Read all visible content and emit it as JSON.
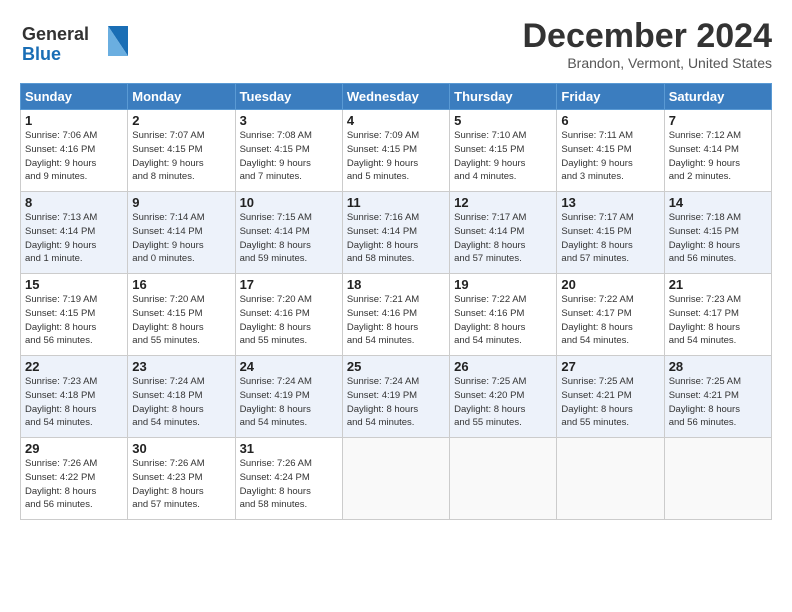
{
  "logo": {
    "line1": "General",
    "line2": "Blue"
  },
  "title": "December 2024",
  "subtitle": "Brandon, Vermont, United States",
  "days_of_week": [
    "Sunday",
    "Monday",
    "Tuesday",
    "Wednesday",
    "Thursday",
    "Friday",
    "Saturday"
  ],
  "weeks": [
    [
      {
        "day": "1",
        "info": "Sunrise: 7:06 AM\nSunset: 4:16 PM\nDaylight: 9 hours\nand 9 minutes."
      },
      {
        "day": "2",
        "info": "Sunrise: 7:07 AM\nSunset: 4:15 PM\nDaylight: 9 hours\nand 8 minutes."
      },
      {
        "day": "3",
        "info": "Sunrise: 7:08 AM\nSunset: 4:15 PM\nDaylight: 9 hours\nand 7 minutes."
      },
      {
        "day": "4",
        "info": "Sunrise: 7:09 AM\nSunset: 4:15 PM\nDaylight: 9 hours\nand 5 minutes."
      },
      {
        "day": "5",
        "info": "Sunrise: 7:10 AM\nSunset: 4:15 PM\nDaylight: 9 hours\nand 4 minutes."
      },
      {
        "day": "6",
        "info": "Sunrise: 7:11 AM\nSunset: 4:15 PM\nDaylight: 9 hours\nand 3 minutes."
      },
      {
        "day": "7",
        "info": "Sunrise: 7:12 AM\nSunset: 4:14 PM\nDaylight: 9 hours\nand 2 minutes."
      }
    ],
    [
      {
        "day": "8",
        "info": "Sunrise: 7:13 AM\nSunset: 4:14 PM\nDaylight: 9 hours\nand 1 minute."
      },
      {
        "day": "9",
        "info": "Sunrise: 7:14 AM\nSunset: 4:14 PM\nDaylight: 9 hours\nand 0 minutes."
      },
      {
        "day": "10",
        "info": "Sunrise: 7:15 AM\nSunset: 4:14 PM\nDaylight: 8 hours\nand 59 minutes."
      },
      {
        "day": "11",
        "info": "Sunrise: 7:16 AM\nSunset: 4:14 PM\nDaylight: 8 hours\nand 58 minutes."
      },
      {
        "day": "12",
        "info": "Sunrise: 7:17 AM\nSunset: 4:14 PM\nDaylight: 8 hours\nand 57 minutes."
      },
      {
        "day": "13",
        "info": "Sunrise: 7:17 AM\nSunset: 4:15 PM\nDaylight: 8 hours\nand 57 minutes."
      },
      {
        "day": "14",
        "info": "Sunrise: 7:18 AM\nSunset: 4:15 PM\nDaylight: 8 hours\nand 56 minutes."
      }
    ],
    [
      {
        "day": "15",
        "info": "Sunrise: 7:19 AM\nSunset: 4:15 PM\nDaylight: 8 hours\nand 56 minutes."
      },
      {
        "day": "16",
        "info": "Sunrise: 7:20 AM\nSunset: 4:15 PM\nDaylight: 8 hours\nand 55 minutes."
      },
      {
        "day": "17",
        "info": "Sunrise: 7:20 AM\nSunset: 4:16 PM\nDaylight: 8 hours\nand 55 minutes."
      },
      {
        "day": "18",
        "info": "Sunrise: 7:21 AM\nSunset: 4:16 PM\nDaylight: 8 hours\nand 54 minutes."
      },
      {
        "day": "19",
        "info": "Sunrise: 7:22 AM\nSunset: 4:16 PM\nDaylight: 8 hours\nand 54 minutes."
      },
      {
        "day": "20",
        "info": "Sunrise: 7:22 AM\nSunset: 4:17 PM\nDaylight: 8 hours\nand 54 minutes."
      },
      {
        "day": "21",
        "info": "Sunrise: 7:23 AM\nSunset: 4:17 PM\nDaylight: 8 hours\nand 54 minutes."
      }
    ],
    [
      {
        "day": "22",
        "info": "Sunrise: 7:23 AM\nSunset: 4:18 PM\nDaylight: 8 hours\nand 54 minutes."
      },
      {
        "day": "23",
        "info": "Sunrise: 7:24 AM\nSunset: 4:18 PM\nDaylight: 8 hours\nand 54 minutes."
      },
      {
        "day": "24",
        "info": "Sunrise: 7:24 AM\nSunset: 4:19 PM\nDaylight: 8 hours\nand 54 minutes."
      },
      {
        "day": "25",
        "info": "Sunrise: 7:24 AM\nSunset: 4:19 PM\nDaylight: 8 hours\nand 54 minutes."
      },
      {
        "day": "26",
        "info": "Sunrise: 7:25 AM\nSunset: 4:20 PM\nDaylight: 8 hours\nand 55 minutes."
      },
      {
        "day": "27",
        "info": "Sunrise: 7:25 AM\nSunset: 4:21 PM\nDaylight: 8 hours\nand 55 minutes."
      },
      {
        "day": "28",
        "info": "Sunrise: 7:25 AM\nSunset: 4:21 PM\nDaylight: 8 hours\nand 56 minutes."
      }
    ],
    [
      {
        "day": "29",
        "info": "Sunrise: 7:26 AM\nSunset: 4:22 PM\nDaylight: 8 hours\nand 56 minutes."
      },
      {
        "day": "30",
        "info": "Sunrise: 7:26 AM\nSunset: 4:23 PM\nDaylight: 8 hours\nand 57 minutes."
      },
      {
        "day": "31",
        "info": "Sunrise: 7:26 AM\nSunset: 4:24 PM\nDaylight: 8 hours\nand 58 minutes."
      },
      {
        "day": "",
        "info": ""
      },
      {
        "day": "",
        "info": ""
      },
      {
        "day": "",
        "info": ""
      },
      {
        "day": "",
        "info": ""
      }
    ]
  ]
}
